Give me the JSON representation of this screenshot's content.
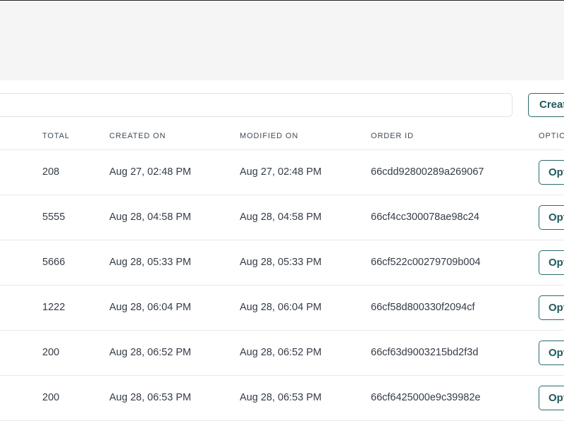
{
  "toolbar": {
    "search_placeholder": "",
    "create_label": "Create"
  },
  "table": {
    "headers": {
      "total": "TOTAL",
      "created_on": "CREATED ON",
      "modified_on": "MODIFIED ON",
      "order_id": "ORDER ID",
      "options": "OPTIONS"
    },
    "rows": [
      {
        "total": "208",
        "created_on": "Aug 27, 02:48 PM",
        "modified_on": "Aug 27, 02:48 PM",
        "order_id": "66cdd92800289a269067",
        "options_label": "Options"
      },
      {
        "total": "5555",
        "created_on": "Aug 28, 04:58 PM",
        "modified_on": "Aug 28, 04:58 PM",
        "order_id": "66cf4cc300078ae98c24",
        "options_label": "Options"
      },
      {
        "total": "5666",
        "created_on": "Aug 28, 05:33 PM",
        "modified_on": "Aug 28, 05:33 PM",
        "order_id": "66cf522c00279709b004",
        "options_label": "Options"
      },
      {
        "total": "1222",
        "created_on": "Aug 28, 06:04 PM",
        "modified_on": "Aug 28, 06:04 PM",
        "order_id": "66cf58d800330f2094cf",
        "options_label": "Options"
      },
      {
        "total": "200",
        "created_on": "Aug 28, 06:52 PM",
        "modified_on": "Aug 28, 06:52 PM",
        "order_id": "66cf63d9003215bd2f3d",
        "options_label": "Options"
      },
      {
        "total": "200",
        "created_on": "Aug 28, 06:53 PM",
        "modified_on": "Aug 28, 06:53 PM",
        "order_id": "66cf6425000e9c39982e",
        "options_label": "Options"
      }
    ]
  },
  "colors": {
    "accent": "#1f5a5e",
    "top_band": "#f5f5f5",
    "divider": "#e8e9eb"
  }
}
